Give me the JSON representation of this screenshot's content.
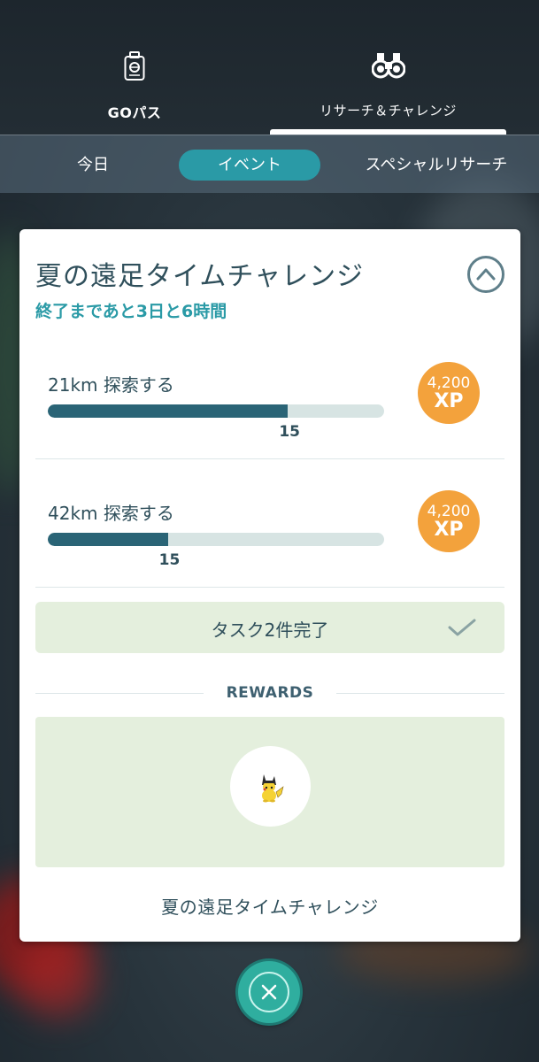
{
  "top_tabs": [
    {
      "label": "GOパス",
      "icon": "pass-icon"
    },
    {
      "label": "リサーチ＆チャレンジ",
      "icon": "binoculars-icon"
    }
  ],
  "sub_tabs": [
    {
      "label": "今日"
    },
    {
      "label": "イベント",
      "selected": true
    },
    {
      "label": "スペシャルリサーチ"
    }
  ],
  "card": {
    "title": "夏の遠足タイムチャレンジ",
    "time_left": "終了まであと3日と6時間",
    "tasks": [
      {
        "label": "21km 探索する",
        "progress_value": "15",
        "progress_fraction": 0.714,
        "reward_amount": "4,200",
        "reward_unit": "XP"
      },
      {
        "label": "42km 探索する",
        "progress_value": "15",
        "progress_fraction": 0.357,
        "reward_amount": "4,200",
        "reward_unit": "XP"
      }
    ],
    "complete_text": "タスク2件完了",
    "rewards_label": "REWARDS",
    "reward_item_icon": "pikachu-icon",
    "reward_name": "夏の遠足タイムチャレンジ"
  },
  "colors": {
    "accent": "#2a9aa6",
    "progress": "#2a6476",
    "xp_badge": "#f3a23c",
    "close_button": "#2fae9f"
  }
}
